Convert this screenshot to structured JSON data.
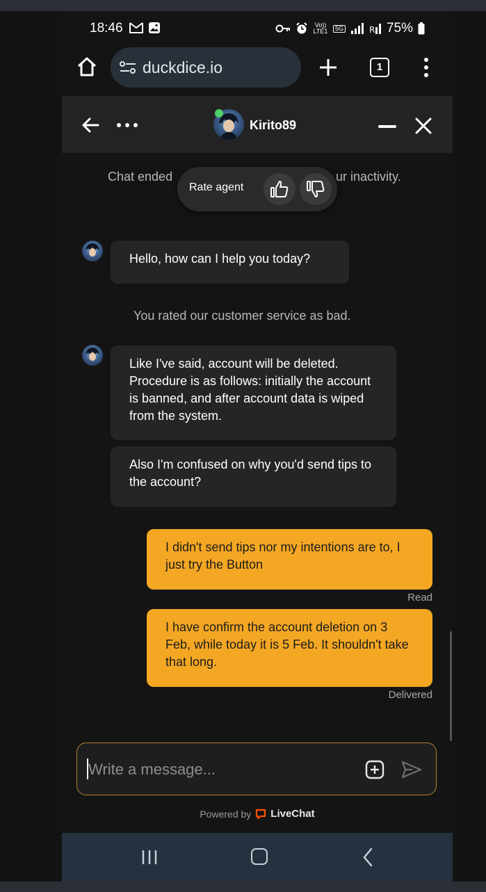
{
  "status_bar": {
    "time": "18:46",
    "net_label": "Vo)) LTE1",
    "fiveg_label": "5G",
    "battery": "75%"
  },
  "browser": {
    "url": "duckdice.io",
    "tab_count": "1"
  },
  "chat_header": {
    "agent_name": "Kirito89"
  },
  "chat": {
    "ended_left": "Chat ended",
    "ended_right": "ur inactivity.",
    "rate_label": "Rate agent",
    "greeting": "Hello, how can I help you today?",
    "rated_notice": "You rated our customer service as bad.",
    "agent_msg_1": "Like I've said, account will be deleted. Procedure is as follows: initially the account is banned, and after account data is wiped from the system.",
    "agent_msg_2": "Also I'm confused on why you'd send tips to the account?",
    "user_msg_1": "I didn't send tips nor my intentions are to, I just try the Button",
    "user_msg_1_status": "Read",
    "user_msg_2": "I have confirm the account deletion on 3 Feb, while today it is 5 Feb. It shouldn't take that long.",
    "user_msg_2_status": "Delivered"
  },
  "composer": {
    "placeholder": "Write a message...",
    "powered_by": "Powered by",
    "brand": "LiveChat"
  },
  "colors": {
    "user_bubble": "#f4a723",
    "agent_bubble": "#252525",
    "livechat_brand": "#ff5100"
  },
  "icons": [
    "home-icon",
    "site-settings-icon",
    "plus-icon",
    "tabs-icon",
    "more-vert-icon",
    "back-arrow-icon",
    "more-horiz-icon",
    "minimize-icon",
    "close-icon",
    "thumbs-up-icon",
    "thumbs-down-icon",
    "attach-icon",
    "send-icon",
    "livechat-logo-icon"
  ]
}
